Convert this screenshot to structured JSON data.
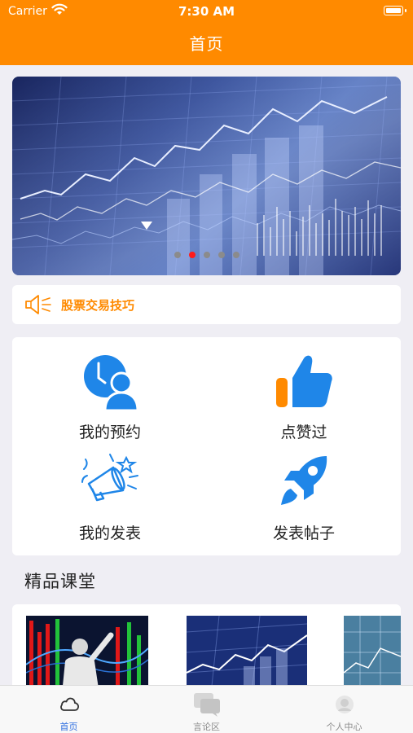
{
  "status_bar": {
    "carrier": "Carrier",
    "time": "7:30 AM"
  },
  "nav": {
    "title": "首页"
  },
  "banner": {
    "page_count": 5,
    "active_page": 2
  },
  "notice": {
    "icon": "speaker-icon",
    "text": "股票交易技巧"
  },
  "grid": {
    "items": [
      {
        "label": "我的预约",
        "icon": "clock-person-icon"
      },
      {
        "label": "点赞过",
        "icon": "thumbs-up-icon"
      },
      {
        "label": "我的发表",
        "icon": "megaphone-icon"
      },
      {
        "label": "发表帖子",
        "icon": "rocket-icon"
      }
    ]
  },
  "section": {
    "title": "精品课堂"
  },
  "tabbar": {
    "tabs": [
      {
        "label": "首页",
        "icon": "cloud-icon",
        "active": true
      },
      {
        "label": "言论区",
        "icon": "chat-icon",
        "active": false
      },
      {
        "label": "个人中心",
        "icon": "person-icon",
        "active": false
      }
    ]
  },
  "colors": {
    "brand": "#ff8a00",
    "accent_blue": "#1f86e8",
    "tab_active": "#2f6fe0",
    "dot_active": "#ff1a1a"
  }
}
